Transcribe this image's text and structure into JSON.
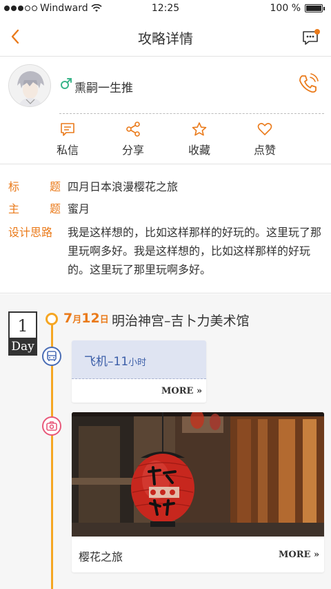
{
  "status_bar": {
    "carrier": "Windward",
    "time": "12:25",
    "battery": "100 %",
    "battery_level": 1.0
  },
  "nav": {
    "title": "攻略详情"
  },
  "profile": {
    "username": "熏嗣一生推"
  },
  "actions": [
    {
      "label": "私信",
      "icon": "message-icon"
    },
    {
      "label": "分享",
      "icon": "share-icon"
    },
    {
      "label": "收藏",
      "icon": "star-icon"
    },
    {
      "label": "点赞",
      "icon": "heart-icon"
    }
  ],
  "info": {
    "title_label": [
      "标",
      "题"
    ],
    "title_value": "四月日本浪漫樱花之旅",
    "theme_label": [
      "主",
      "题"
    ],
    "theme_value": "蜜月",
    "idea_label": "设计思路",
    "idea_value": "我是这样想的，比如这样那样的好玩的。这里玩了那里玩啊多好。我是这样想的，比如这样那样的好玩的。这里玩了那里玩啊多好。"
  },
  "day": {
    "number": "1",
    "label": "Day",
    "date_month": "7",
    "date_month_unit": "月",
    "date_day": "12",
    "date_day_unit": "日",
    "place": "明治神宫–吉卜力美术馆"
  },
  "transport_card": {
    "mode": "飞机–11",
    "unit": "小时",
    "more": "MORE"
  },
  "photo_card": {
    "caption": "樱花之旅",
    "more": "MORE"
  },
  "colors": {
    "accent": "#ea7a1a",
    "timeline": "#f5a623",
    "transport": "#3b5ea8",
    "camera": "#e8587a"
  }
}
